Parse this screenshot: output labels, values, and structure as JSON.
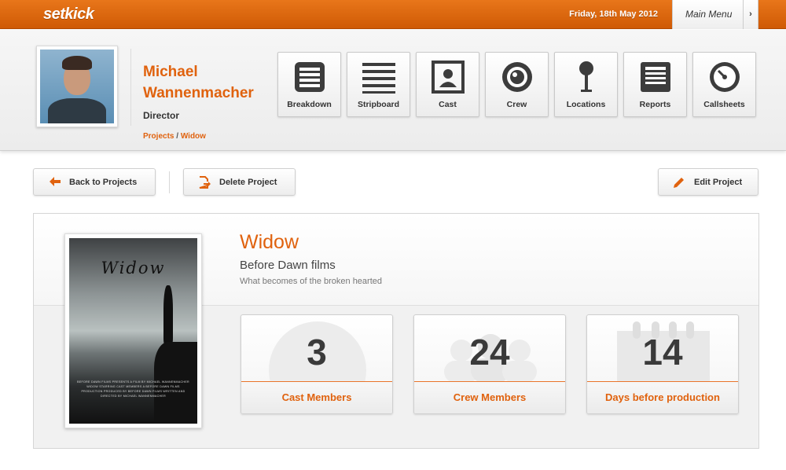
{
  "app": {
    "logo": "setkick"
  },
  "topbar": {
    "date": "Friday, 18th May 2012",
    "main_menu": "Main Menu",
    "menu_arrow": "›"
  },
  "user": {
    "name": "Michael Wannenmacher",
    "role": "Director",
    "breadcrumb": {
      "projects": "Projects",
      "separator": "/",
      "current": "Widow"
    }
  },
  "nav": {
    "tiles": [
      {
        "label": "Breakdown",
        "icon": "breakdown-icon"
      },
      {
        "label": "Stripboard",
        "icon": "stripboard-icon"
      },
      {
        "label": "Cast",
        "icon": "cast-icon"
      },
      {
        "label": "Crew",
        "icon": "crew-icon"
      },
      {
        "label": "Locations",
        "icon": "locations-icon"
      },
      {
        "label": "Reports",
        "icon": "reports-icon"
      },
      {
        "label": "Callsheets",
        "icon": "callsheets-icon"
      }
    ]
  },
  "actions": {
    "back": "Back to Projects",
    "delete": "Delete Project",
    "edit": "Edit Project"
  },
  "project": {
    "title": "Widow",
    "company": "Before Dawn films",
    "tagline": "What becomes of the broken hearted",
    "poster_title": "Widow",
    "poster_credits": "BEFORE DAWN FILMS PRESENTS A FILM BY MICHAEL WANNENMACHER WIDOW STARRING CAST MEMBERS A BEFORE DAWN FILMS PRODUCTION PRODUCED BY BEFORE DAWN FILMS WRITTEN AND DIRECTED BY MICHAEL WANNENMACHER"
  },
  "stats": [
    {
      "value": "3",
      "label": "Cast Members"
    },
    {
      "value": "24",
      "label": "Crew Members"
    },
    {
      "value": "14",
      "label": "Days before production"
    }
  ],
  "colors": {
    "accent": "#e0620e",
    "topbar": "#db6810"
  }
}
